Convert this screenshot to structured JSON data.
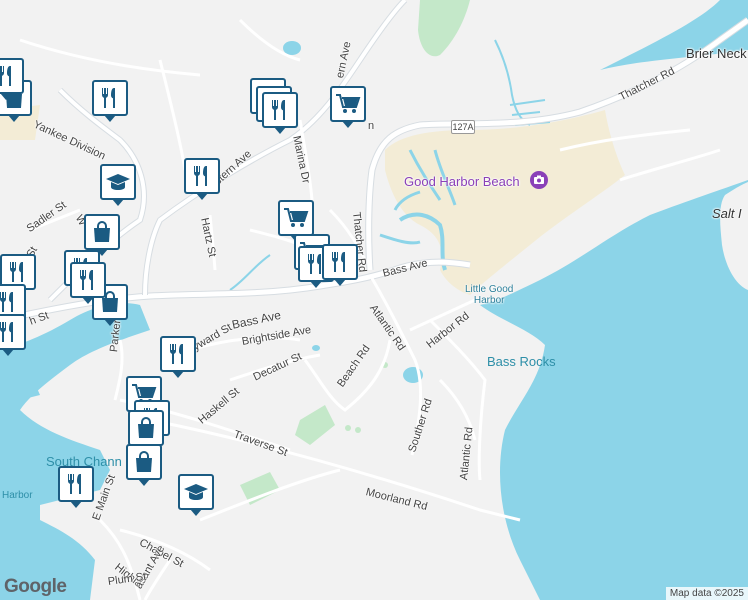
{
  "map": {
    "attribution": "Map data ©2025",
    "logo": "Google",
    "route_shield": "127A",
    "colors": {
      "water": "#8cd4e8",
      "land": "#f2f2f2",
      "beach": "#f3ecd6",
      "park": "#c4e8c9",
      "road": "#ffffff",
      "road_major": "#d7dde2",
      "pin_border": "#1b5b82"
    },
    "labels": {
      "brier_neck": "Brier Neck",
      "thatcher_rd_top": "Thatcher Rd",
      "good_harbor_beach": "Good Harbor Beach",
      "salt_island": "Salt I",
      "little_good_harbor": "Little Good\nHarbor",
      "bass_rocks": "Bass Rocks",
      "south_channel": "South Chann",
      "harbor": "Harbor",
      "yankee_division": "Yankee Division",
      "eastern_ave": "Eastern Ave",
      "eastern_ave_top": "ern Ave",
      "marina_dr": "Marina Dr",
      "hartz_st": "Hartz St",
      "sadler_st": "Sadler St",
      "thatcher_rd": "Thatcher Rd",
      "bass_ave": "Bass Ave",
      "bass_ave_right": "Bass Ave",
      "atlantic_rd": "Atlantic Rd",
      "harbor_rd": "Harbor Rd",
      "brightside_ave": "Brightside Ave",
      "hayward_st": "yward St",
      "decatur_st": "Decatur St",
      "beach_rd": "Beach Rd",
      "traverse_st": "Traverse St",
      "haskell_st": "Haskell St",
      "souther_rd": "Souther Rd",
      "atlantic_rd_lower": "Atlantic Rd",
      "moorland_rd": "Moorland Rd",
      "parker_st": "Parker St",
      "e_main_st": "E Main St",
      "chapel_st": "Chapel St",
      "highland": "Highla",
      "pleasant_ave": "asant Ave",
      "plum_st": "Plum St",
      "nd_st": "nd St",
      "h_st": "h St",
      "w_st": "W",
      "n_st": "n"
    },
    "pins": [
      {
        "icon": "shopping-bag-icon"
      },
      {
        "icon": "restaurant-icon"
      },
      {
        "icon": "graduation-cap-icon"
      },
      {
        "icon": "restaurant-icon"
      },
      {
        "icon": "shopping-bag-icon"
      },
      {
        "icon": "restaurant-icon"
      },
      {
        "icon": "restaurant-icon"
      },
      {
        "icon": "shopping-bag-icon"
      },
      {
        "icon": "restaurant-icon"
      },
      {
        "icon": "restaurant-icon"
      },
      {
        "icon": "restaurant-icon"
      },
      {
        "icon": "restaurant-icon"
      },
      {
        "icon": "restaurant-icon"
      },
      {
        "icon": "shopping-cart-icon"
      },
      {
        "icon": "shopping-cart-icon"
      },
      {
        "icon": "restaurant-icon"
      },
      {
        "icon": "restaurant-icon"
      },
      {
        "icon": "shopping-cart-icon"
      },
      {
        "icon": "restaurant-icon"
      },
      {
        "icon": "restaurant-icon"
      },
      {
        "icon": "restaurant-icon"
      },
      {
        "icon": "shopping-cart-icon"
      },
      {
        "icon": "restaurant-icon"
      },
      {
        "icon": "shopping-bag-icon"
      },
      {
        "icon": "shopping-bag-icon"
      },
      {
        "icon": "restaurant-icon"
      },
      {
        "icon": "graduation-cap-icon"
      }
    ]
  }
}
